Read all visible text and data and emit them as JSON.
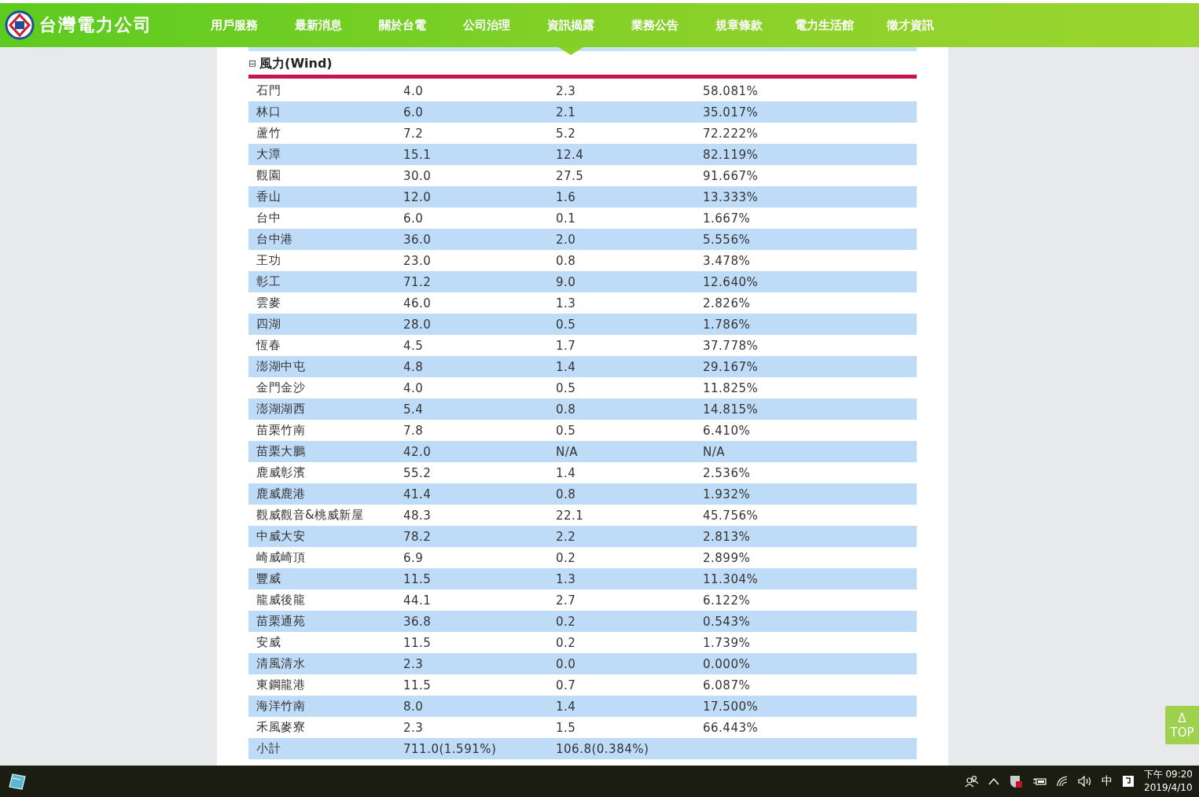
{
  "header": {
    "logo_text": "台灣電力公司",
    "nav": [
      {
        "label": "用戶服務",
        "selected": false
      },
      {
        "label": "最新消息",
        "selected": false
      },
      {
        "label": "關於台電",
        "selected": false
      },
      {
        "label": "公司治理",
        "selected": false
      },
      {
        "label": "資訊揭露",
        "selected": true
      },
      {
        "label": "業務公告",
        "selected": false
      },
      {
        "label": "規章條款",
        "selected": false
      },
      {
        "label": "電力生活館",
        "selected": false
      },
      {
        "label": "徵才資訊",
        "selected": false
      }
    ]
  },
  "section": {
    "toggle": "⊟",
    "title": "風力(Wind)",
    "rows": [
      [
        "石門",
        "4.0",
        "2.3",
        "58.081%"
      ],
      [
        "林口",
        "6.0",
        "2.1",
        "35.017%"
      ],
      [
        "蘆竹",
        "7.2",
        "5.2",
        "72.222%"
      ],
      [
        "大潭",
        "15.1",
        "12.4",
        "82.119%"
      ],
      [
        "觀園",
        "30.0",
        "27.5",
        "91.667%"
      ],
      [
        "香山",
        "12.0",
        "1.6",
        "13.333%"
      ],
      [
        "台中",
        "6.0",
        "0.1",
        "1.667%"
      ],
      [
        "台中港",
        "36.0",
        "2.0",
        "5.556%"
      ],
      [
        "王功",
        "23.0",
        "0.8",
        "3.478%"
      ],
      [
        "彰工",
        "71.2",
        "9.0",
        "12.640%"
      ],
      [
        "雲麥",
        "46.0",
        "1.3",
        "2.826%"
      ],
      [
        "四湖",
        "28.0",
        "0.5",
        "1.786%"
      ],
      [
        "恆春",
        "4.5",
        "1.7",
        "37.778%"
      ],
      [
        "澎湖中屯",
        "4.8",
        "1.4",
        "29.167%"
      ],
      [
        "金門金沙",
        "4.0",
        "0.5",
        "11.825%"
      ],
      [
        "澎湖湖西",
        "5.4",
        "0.8",
        "14.815%"
      ],
      [
        "苗栗竹南",
        "7.8",
        "0.5",
        "6.410%"
      ],
      [
        "苗栗大鵬",
        "42.0",
        "N/A",
        "N/A"
      ],
      [
        "鹿威彰濱",
        "55.2",
        "1.4",
        "2.536%"
      ],
      [
        "鹿威鹿港",
        "41.4",
        "0.8",
        "1.932%"
      ],
      [
        "觀威觀音&桃威新屋",
        "48.3",
        "22.1",
        "45.756%"
      ],
      [
        "中威大安",
        "78.2",
        "2.2",
        "2.813%"
      ],
      [
        "崎威崎頂",
        "6.9",
        "0.2",
        "2.899%"
      ],
      [
        "豐威",
        "11.5",
        "1.3",
        "11.304%"
      ],
      [
        "龍威後龍",
        "44.1",
        "2.7",
        "6.122%"
      ],
      [
        "苗栗通苑",
        "36.8",
        "0.2",
        "0.543%"
      ],
      [
        "安威",
        "11.5",
        "0.2",
        "1.739%"
      ],
      [
        "清風清水",
        "2.3",
        "0.0",
        "0.000%"
      ],
      [
        "東鋼龍港",
        "11.5",
        "0.7",
        "6.087%"
      ],
      [
        "海洋竹南",
        "8.0",
        "1.4",
        "17.500%"
      ],
      [
        "禾風麥寮",
        "2.3",
        "1.5",
        "66.443%"
      ]
    ],
    "subtotal": [
      "小計",
      "711.0(1.591%)",
      "106.8(0.384%)"
    ]
  },
  "top_button": {
    "arrow": "Δ",
    "label": "TOP"
  },
  "taskbar": {
    "ime": "中",
    "time": "下午 09:20",
    "date": "2019/4/10"
  }
}
